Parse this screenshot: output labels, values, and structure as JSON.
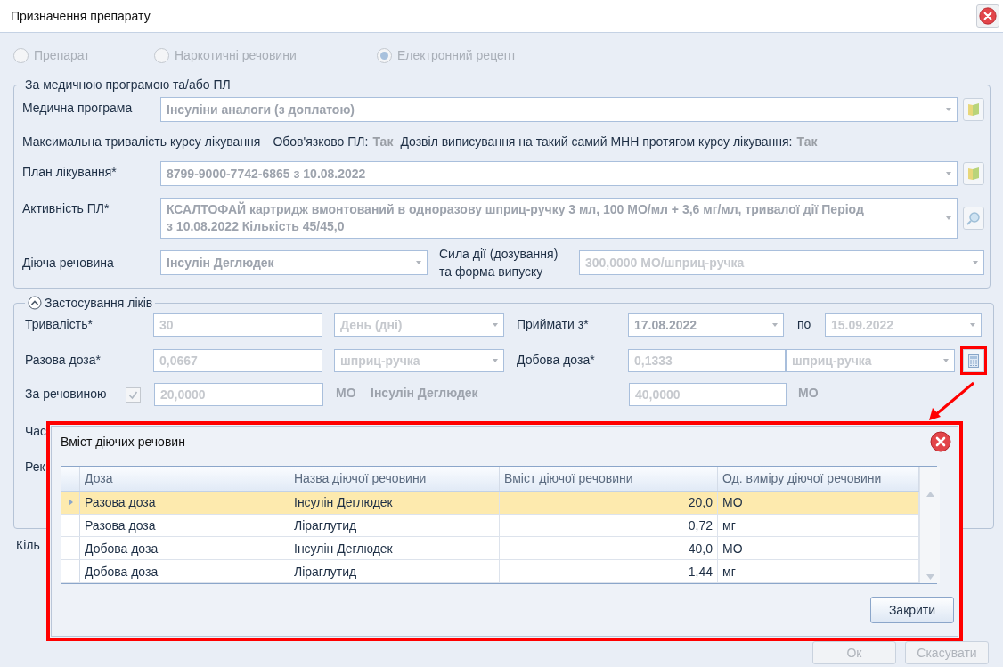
{
  "window": {
    "title": "Призначення препарату"
  },
  "source_options": [
    {
      "label": "Препарат",
      "selected": false
    },
    {
      "label": "Наркотичні речовини",
      "selected": false
    },
    {
      "label": "Електронний рецепт",
      "selected": true
    }
  ],
  "program_group": {
    "title": "За медичною програмою та/або ПЛ",
    "medical_program": {
      "label": "Медична програма",
      "value": "Інсуліни аналоги (з доплатою)"
    },
    "info": {
      "max_duration": "Максимальна тривалість курсу лікування",
      "required_label": "Обов'язково ПЛ:",
      "required_value": "Так",
      "permission_label": "Дозвіл виписування на такий самий МНН протягом курсу лікування:",
      "permission_value": "Так"
    },
    "treatment_plan": {
      "label": "План лікування*",
      "value": "8799-9000-7742-6865 з 10.08.2022"
    },
    "activity": {
      "label": "Активність ПЛ*",
      "value_lines": [
        "КСАЛТОФАЙ картридж вмонтований в одноразову шприц-ручку 3 мл, 100 МО/мл + 3,6 мг/мл, тривалої дії Період",
        "з 10.08.2022 Кількість 45/45,0"
      ]
    },
    "substance": {
      "label": "Діюча речовина",
      "value": "Інсулін Деглюдек"
    },
    "strength": {
      "label_lines": [
        "Сила дії (дозування)",
        "та форма випуску"
      ],
      "value": "300,0000 МО/шприц-ручка"
    }
  },
  "usage_group": {
    "title": "Застосування ліків",
    "expanded": true,
    "duration": {
      "label": "Тривалість*",
      "value": "30",
      "unit": "День (дні)"
    },
    "start": {
      "label": "Приймати з*",
      "value": "17.08.2022"
    },
    "end": {
      "label": "по",
      "value": "15.09.2022"
    },
    "single_dose": {
      "label": "Разова доза*",
      "value": "0,0667",
      "unit": "шприц-ручка"
    },
    "daily_dose": {
      "label": "Добова доза*",
      "value": "0,1333",
      "unit": "шприц-ручка"
    },
    "by_substance": {
      "label": "За речовиною",
      "checked": true,
      "single_amount": "20,0000",
      "single_unit": "МО",
      "substance": "Інсулін Деглюдек",
      "daily_amount": "40,0000",
      "daily_unit": "МО"
    },
    "hidden_labels": [
      "Час",
      "Рек"
    ]
  },
  "quantity_label": "Кіль",
  "buttons": [
    {
      "label": "Ок"
    },
    {
      "label": "Скасувати"
    }
  ],
  "dialog": {
    "title": "Вміст діючих речовин",
    "columns": [
      "Доза",
      "Назва діючої речовини",
      "Вміст діючої речовини",
      "Од. виміру діючої речовини"
    ],
    "rows": [
      {
        "cells": [
          "Разова доза",
          "Інсулін Деглюдек",
          "20,0",
          "МО"
        ],
        "selected": true
      },
      {
        "cells": [
          "Разова доза",
          "Ліраглутид",
          "0,72",
          "мг"
        ],
        "selected": false
      },
      {
        "cells": [
          "Добова доза",
          "Інсулін Деглюдек",
          "40,0",
          "МО"
        ],
        "selected": false
      },
      {
        "cells": [
          "Добова доза",
          "Ліраглутид",
          "1,44",
          "мг"
        ],
        "selected": false
      }
    ],
    "close_button": "Закрити"
  }
}
